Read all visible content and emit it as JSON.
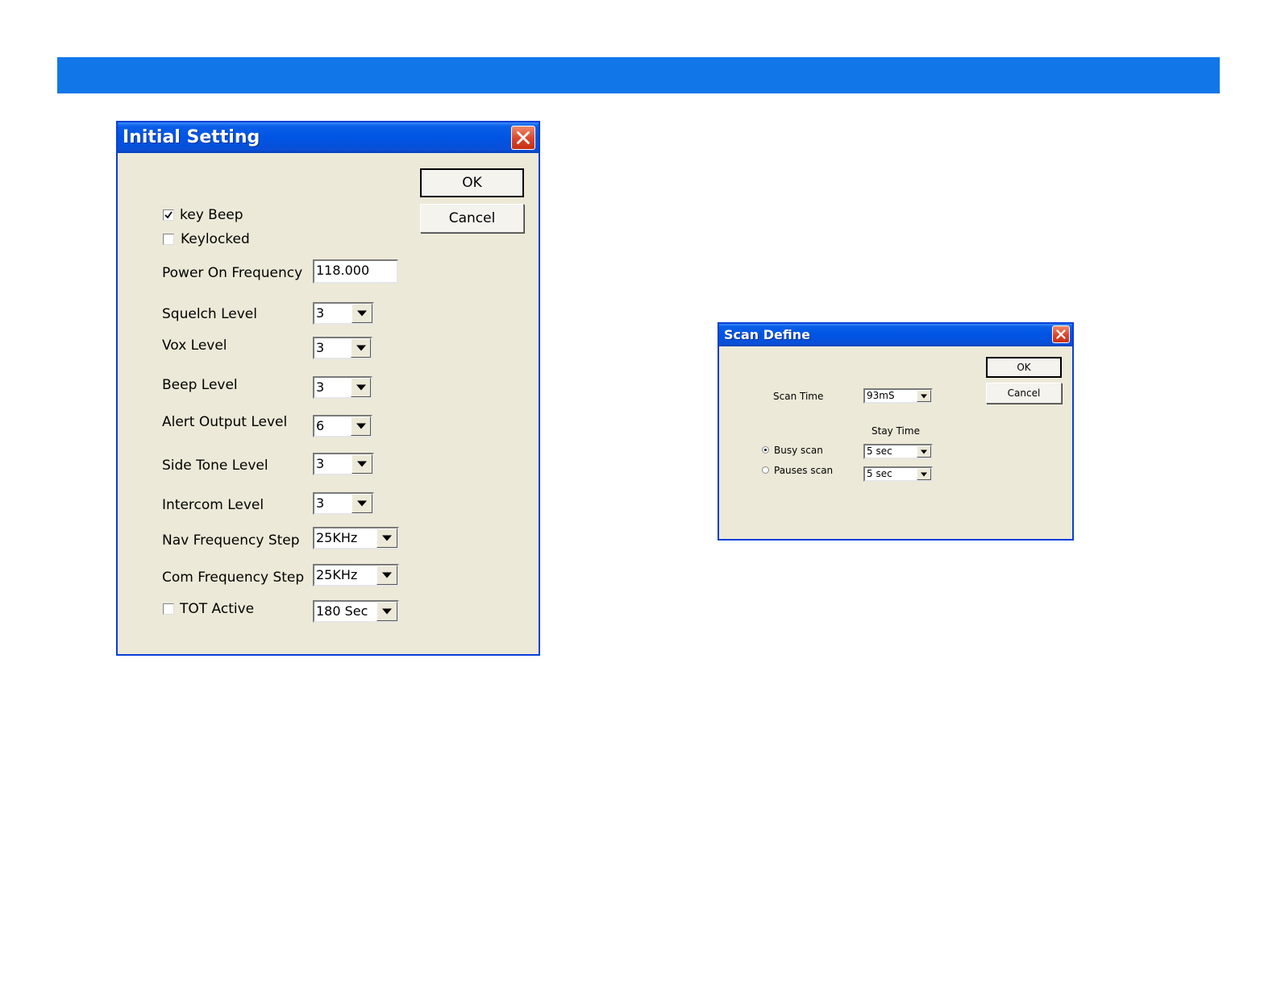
{
  "colors": {
    "banner": "#1177e9",
    "titlebar": "#0054e3",
    "dialog_face": "#ece9d8",
    "close_button": "#d9452a"
  },
  "initial_setting": {
    "title": "Initial Setting",
    "ok_label": "OK",
    "cancel_label": "Cancel",
    "key_beep": {
      "label": "key Beep",
      "checked": true
    },
    "keylocked": {
      "label": "Keylocked",
      "checked": false
    },
    "power_on_frequency": {
      "label": "Power On Frequency",
      "value": "118.000"
    },
    "squelch_level": {
      "label": "Squelch Level",
      "value": "3"
    },
    "vox_level": {
      "label": "Vox Level",
      "value": "3"
    },
    "beep_level": {
      "label": "Beep Level",
      "value": "3"
    },
    "alert_output_level": {
      "label": "Alert Output Level",
      "value": "6"
    },
    "side_tone_level": {
      "label": "Side Tone Level",
      "value": "3"
    },
    "intercom_level": {
      "label": "Intercom Level",
      "value": "3"
    },
    "nav_frequency_step": {
      "label": "Nav Frequency Step",
      "value": "25KHz"
    },
    "com_frequency_step": {
      "label": "Com Frequency Step",
      "value": "25KHz"
    },
    "tot_active": {
      "label": "TOT Active",
      "checked": false,
      "value": "180 Sec"
    }
  },
  "scan_define": {
    "title": "Scan Define",
    "ok_label": "OK",
    "cancel_label": "Cancel",
    "scan_time": {
      "label": "Scan Time",
      "value": "93mS"
    },
    "stay_time_label": "Stay Time",
    "busy_scan": {
      "label": "Busy scan",
      "selected": true,
      "value": "5 sec"
    },
    "pauses_scan": {
      "label": "Pauses scan",
      "selected": false,
      "value": "5 sec"
    }
  }
}
